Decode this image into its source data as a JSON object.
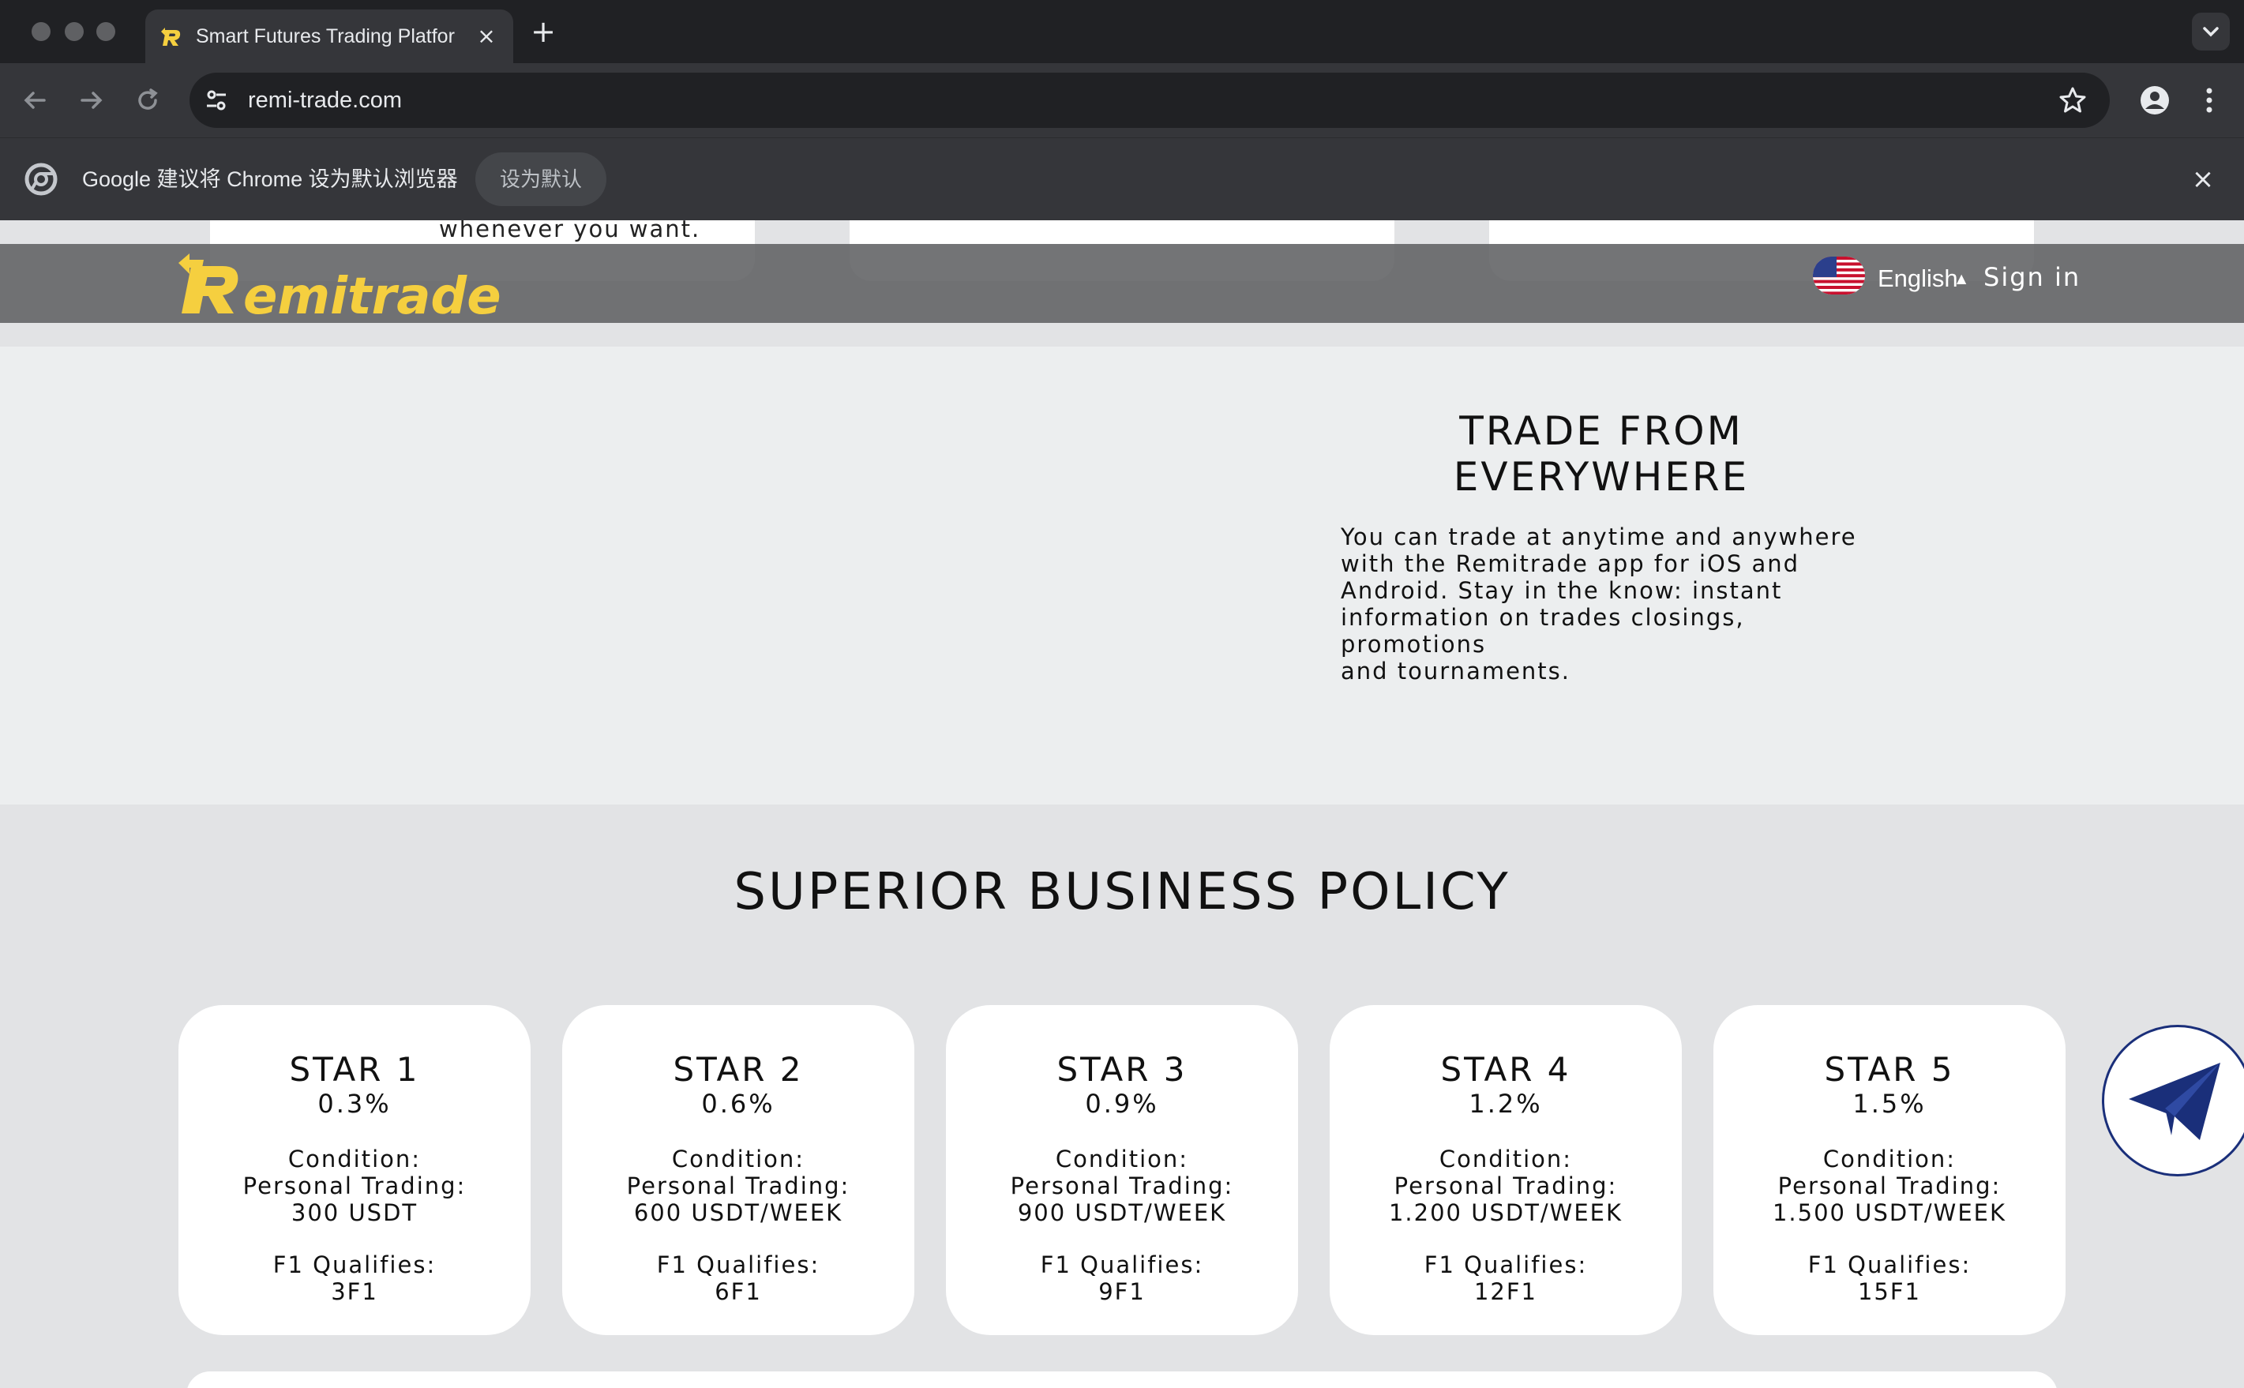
{
  "browser": {
    "tab_title": "Smart Futures Trading Platfor",
    "tab_close": "×",
    "new_tab": "+",
    "url": "remi-trade.com",
    "infobar_text": "Google 建议将 Chrome 设为默认浏览器",
    "infobar_button": "设为默认",
    "infobar_close": "×"
  },
  "previous_section": {
    "trailing_text": "whenever you want."
  },
  "header": {
    "logo_text": "Remitrade",
    "language": "English",
    "language_caret": "▲",
    "signin": "Sign in"
  },
  "trade": {
    "title_line1": "TRADE FROM",
    "title_line2": "EVERYWHERE",
    "desc_line1": "You can trade at anytime and anywhere",
    "desc_line2": "with the Remitrade app for iOS and",
    "desc_line3": "Android. Stay in the know: instant",
    "desc_line4": "information on trades closings, promotions",
    "desc_line5": "and tournaments."
  },
  "policy": {
    "title": "SUPERIOR BUSINESS POLICY",
    "cards": [
      {
        "name": "STAR 1",
        "rate": "0.3%",
        "condition": "Condition:",
        "trading_label": "Personal Trading:",
        "trading_value": "300 USDT",
        "f1_label": "F1 Qualifies:",
        "f1_value": "3F1"
      },
      {
        "name": "STAR 2",
        "rate": "0.6%",
        "condition": "Condition:",
        "trading_label": "Personal Trading:",
        "trading_value": "600 USDT/WEEK",
        "f1_label": "F1 Qualifies:",
        "f1_value": "6F1"
      },
      {
        "name": "STAR 3",
        "rate": "0.9%",
        "condition": "Condition:",
        "trading_label": "Personal Trading:",
        "trading_value": "900 USDT/WEEK",
        "f1_label": "F1 Qualifies:",
        "f1_value": "9F1"
      },
      {
        "name": "STAR 4",
        "rate": "1.2%",
        "condition": "Condition:",
        "trading_label": "Personal Trading:",
        "trading_value": "1.200 USDT/WEEK",
        "f1_label": "F1 Qualifies:",
        "f1_value": "12F1"
      },
      {
        "name": "STAR 5",
        "rate": "1.5%",
        "condition": "Condition:",
        "trading_label": "Personal Trading:",
        "trading_value": "1.500 USDT/WEEK",
        "f1_label": "F1 Qualifies:",
        "f1_value": "15F1"
      }
    ]
  },
  "colors": {
    "brand_yellow": "#f5cf3f",
    "telegram_blue": "#1a2f7a"
  }
}
